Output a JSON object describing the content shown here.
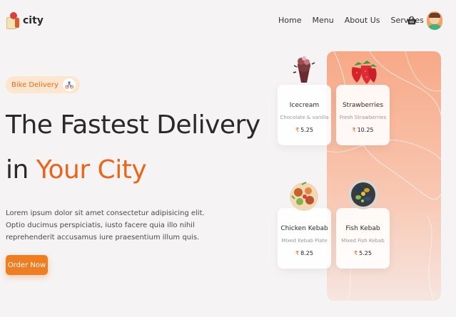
{
  "brand": {
    "name": "city",
    "logo_icon": "delivery-bag-logo-icon"
  },
  "nav": {
    "links": [
      "Home",
      "Menu",
      "About Us",
      "Services"
    ],
    "basket_icon": "basket-icon",
    "avatar_icon": "user-avatar-icon"
  },
  "hero": {
    "badge": "Bike Delivery",
    "badge_icon": "bike-delivery-icon",
    "title_line1": "The Fastest Delivery",
    "title_line2_prefix": "in ",
    "title_line2_accent": "Your City",
    "description": "Lorem ipsum dolor sit amet consectetur adipisicing elit. Optio ducimus perspiciatis, iusto facere quia illo nihil reprehenderit accusamus iure praesentium illum quis.",
    "cta": "Order Now"
  },
  "colors": {
    "accent": "#e8651a",
    "button": "#ef7d22",
    "badge_bg": "#fde6cf"
  },
  "menu_items": [
    {
      "name": "Icecream",
      "subtitle": "Chocolate & vanilla",
      "currency": "₹",
      "price": "5.25",
      "image": "icecream-image"
    },
    {
      "name": "Strawberries",
      "subtitle": "Fresh Strawberries",
      "currency": "₹",
      "price": "10.25",
      "image": "strawberries-image"
    },
    {
      "name": "Chicken Kebab",
      "subtitle": "Mixed Kebab Plate",
      "currency": "₹",
      "price": "8.25",
      "image": "chicken-kebab-image"
    },
    {
      "name": "Fish Kebab",
      "subtitle": "Mixed Fish Kebab",
      "currency": "₹",
      "price": "5.25",
      "image": "fish-kebab-image"
    }
  ]
}
